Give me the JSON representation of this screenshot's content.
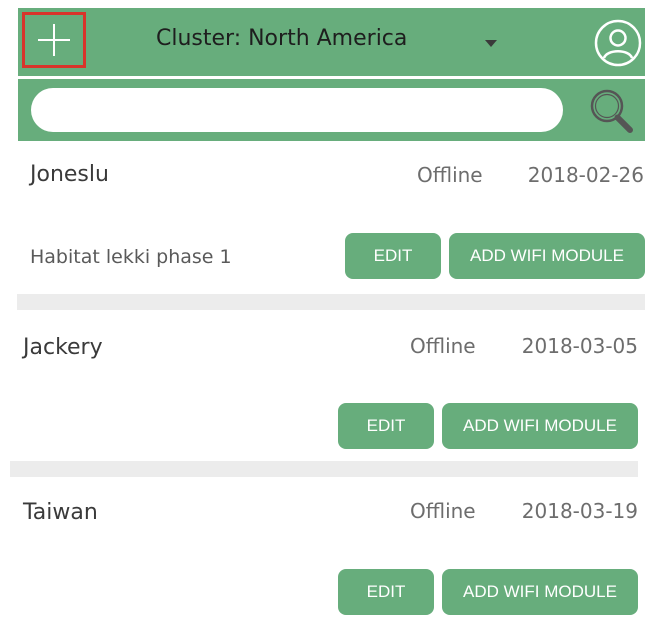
{
  "header": {
    "cluster_label": "Cluster: North America"
  },
  "search": {
    "placeholder": ""
  },
  "buttons": {
    "edit": "EDIT",
    "add_wifi": "ADD WIFI MODULE"
  },
  "devices": [
    {
      "name": "Joneslu",
      "status": "Offline",
      "date": "2018-02-26",
      "location": "Habitat lekki phase 1"
    },
    {
      "name": "Jackery",
      "status": "Offline",
      "date": "2018-03-05",
      "location": ""
    },
    {
      "name": "Taiwan",
      "status": "Offline",
      "date": "2018-03-19",
      "location": ""
    }
  ],
  "colors": {
    "accent": "#67ad7c",
    "highlight": "#d9342b",
    "separator": "#ececec"
  },
  "icons": [
    "plus-icon",
    "chevron-down-icon",
    "user-icon",
    "search-icon"
  ]
}
